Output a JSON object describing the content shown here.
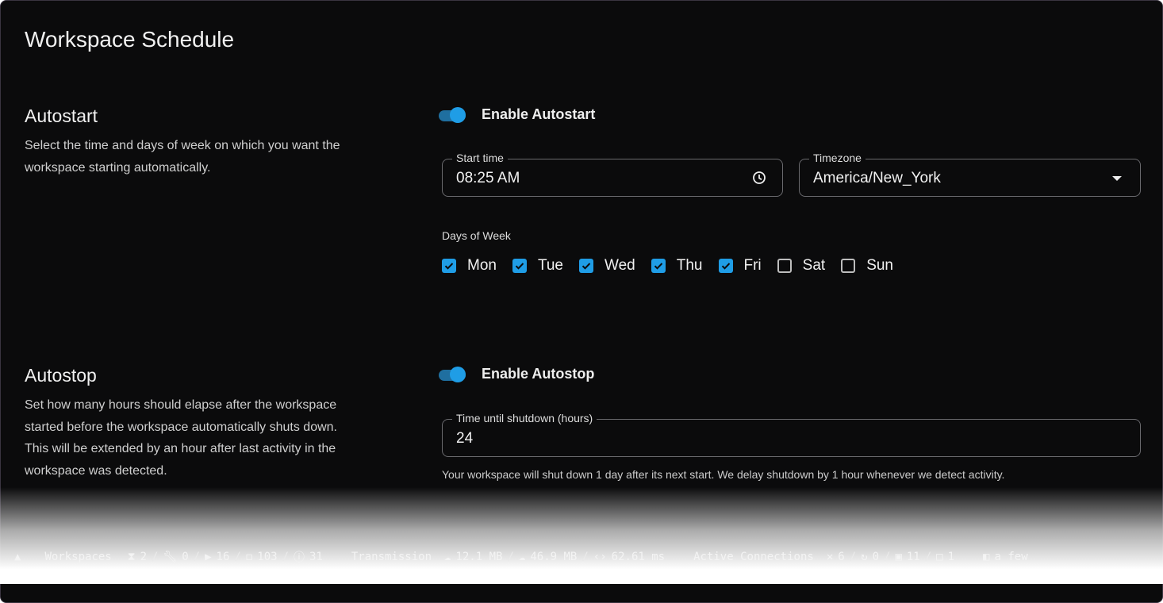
{
  "title": "Workspace Schedule",
  "autostart": {
    "title": "Autostart",
    "description": "Select the time and days of week on which you want the workspace starting automatically.",
    "toggle_label": "Enable Autostart",
    "enabled": true,
    "start_time_label": "Start time",
    "start_time": "08:25 AM",
    "timezone_label": "Timezone",
    "timezone": "America/New_York",
    "days_label": "Days of Week",
    "days": [
      {
        "label": "Mon",
        "checked": true
      },
      {
        "label": "Tue",
        "checked": true
      },
      {
        "label": "Wed",
        "checked": true
      },
      {
        "label": "Thu",
        "checked": true
      },
      {
        "label": "Fri",
        "checked": true
      },
      {
        "label": "Sat",
        "checked": false
      },
      {
        "label": "Sun",
        "checked": false
      }
    ]
  },
  "autostop": {
    "title": "Autostop",
    "description": "Set how many hours should elapse after the workspace started before the workspace automatically shuts down. This will be extended by an hour after last activity in the workspace was detected.",
    "toggle_label": "Enable Autostop",
    "enabled": true,
    "ttl_label": "Time until shutdown (hours)",
    "ttl": "24",
    "helper": "Your workspace will shut down 1 day after its next start. We delay shutdown by 1 hour whenever we detect activity."
  },
  "statusbar": {
    "workspaces_label": "Workspaces",
    "pending": "2",
    "building": "0",
    "running": "16",
    "stopped": "103",
    "failed": "31",
    "transmission_label": "Transmission",
    "tx": "12.1 MB",
    "rx": "46.9 MB",
    "latency": "62.61 ms",
    "connections_label": "Active Connections",
    "vscode": "6",
    "jetbrains": "0",
    "terminal": "11",
    "ssh": "1",
    "updated": "a few"
  }
}
